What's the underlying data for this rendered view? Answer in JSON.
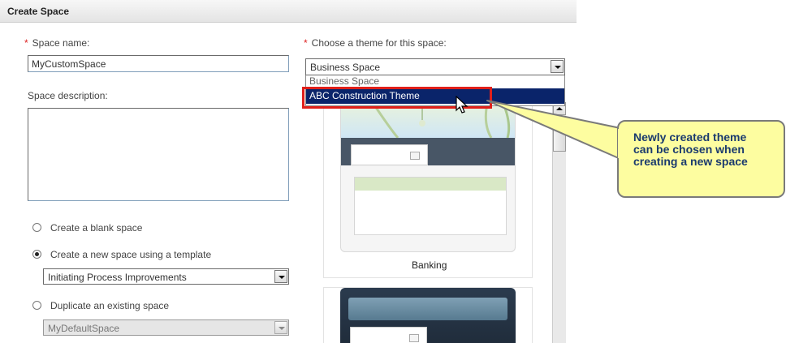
{
  "dialog": {
    "title": "Create Space"
  },
  "space_name": {
    "label": "Space name:",
    "value": "MyCustomSpace"
  },
  "space_description": {
    "label": "Space description:",
    "value": ""
  },
  "options": {
    "blank": {
      "label": "Create a blank space",
      "checked": false
    },
    "template": {
      "label": "Create a new space using a template",
      "checked": true,
      "selected": "Initiating Process Improvements"
    },
    "duplicate": {
      "label": "Duplicate an existing space",
      "checked": false,
      "selected": "MyDefaultSpace"
    }
  },
  "theme": {
    "label": "Choose a theme for this space:",
    "selected": "Business Space",
    "dropdown_items": [
      "Business Space",
      "ABC Construction Theme"
    ],
    "highlighted": "ABC Construction Theme",
    "preview_label": "Banking"
  },
  "callout": {
    "lines": [
      "Newly created theme",
      "can be chosen when",
      "creating a new space"
    ]
  },
  "colors": {
    "highlight": "#0a246a",
    "annotation_box": "#e0201a",
    "callout_bg": "#fdfda0",
    "callout_text": "#1a3a6e",
    "required": "#dd2222"
  }
}
